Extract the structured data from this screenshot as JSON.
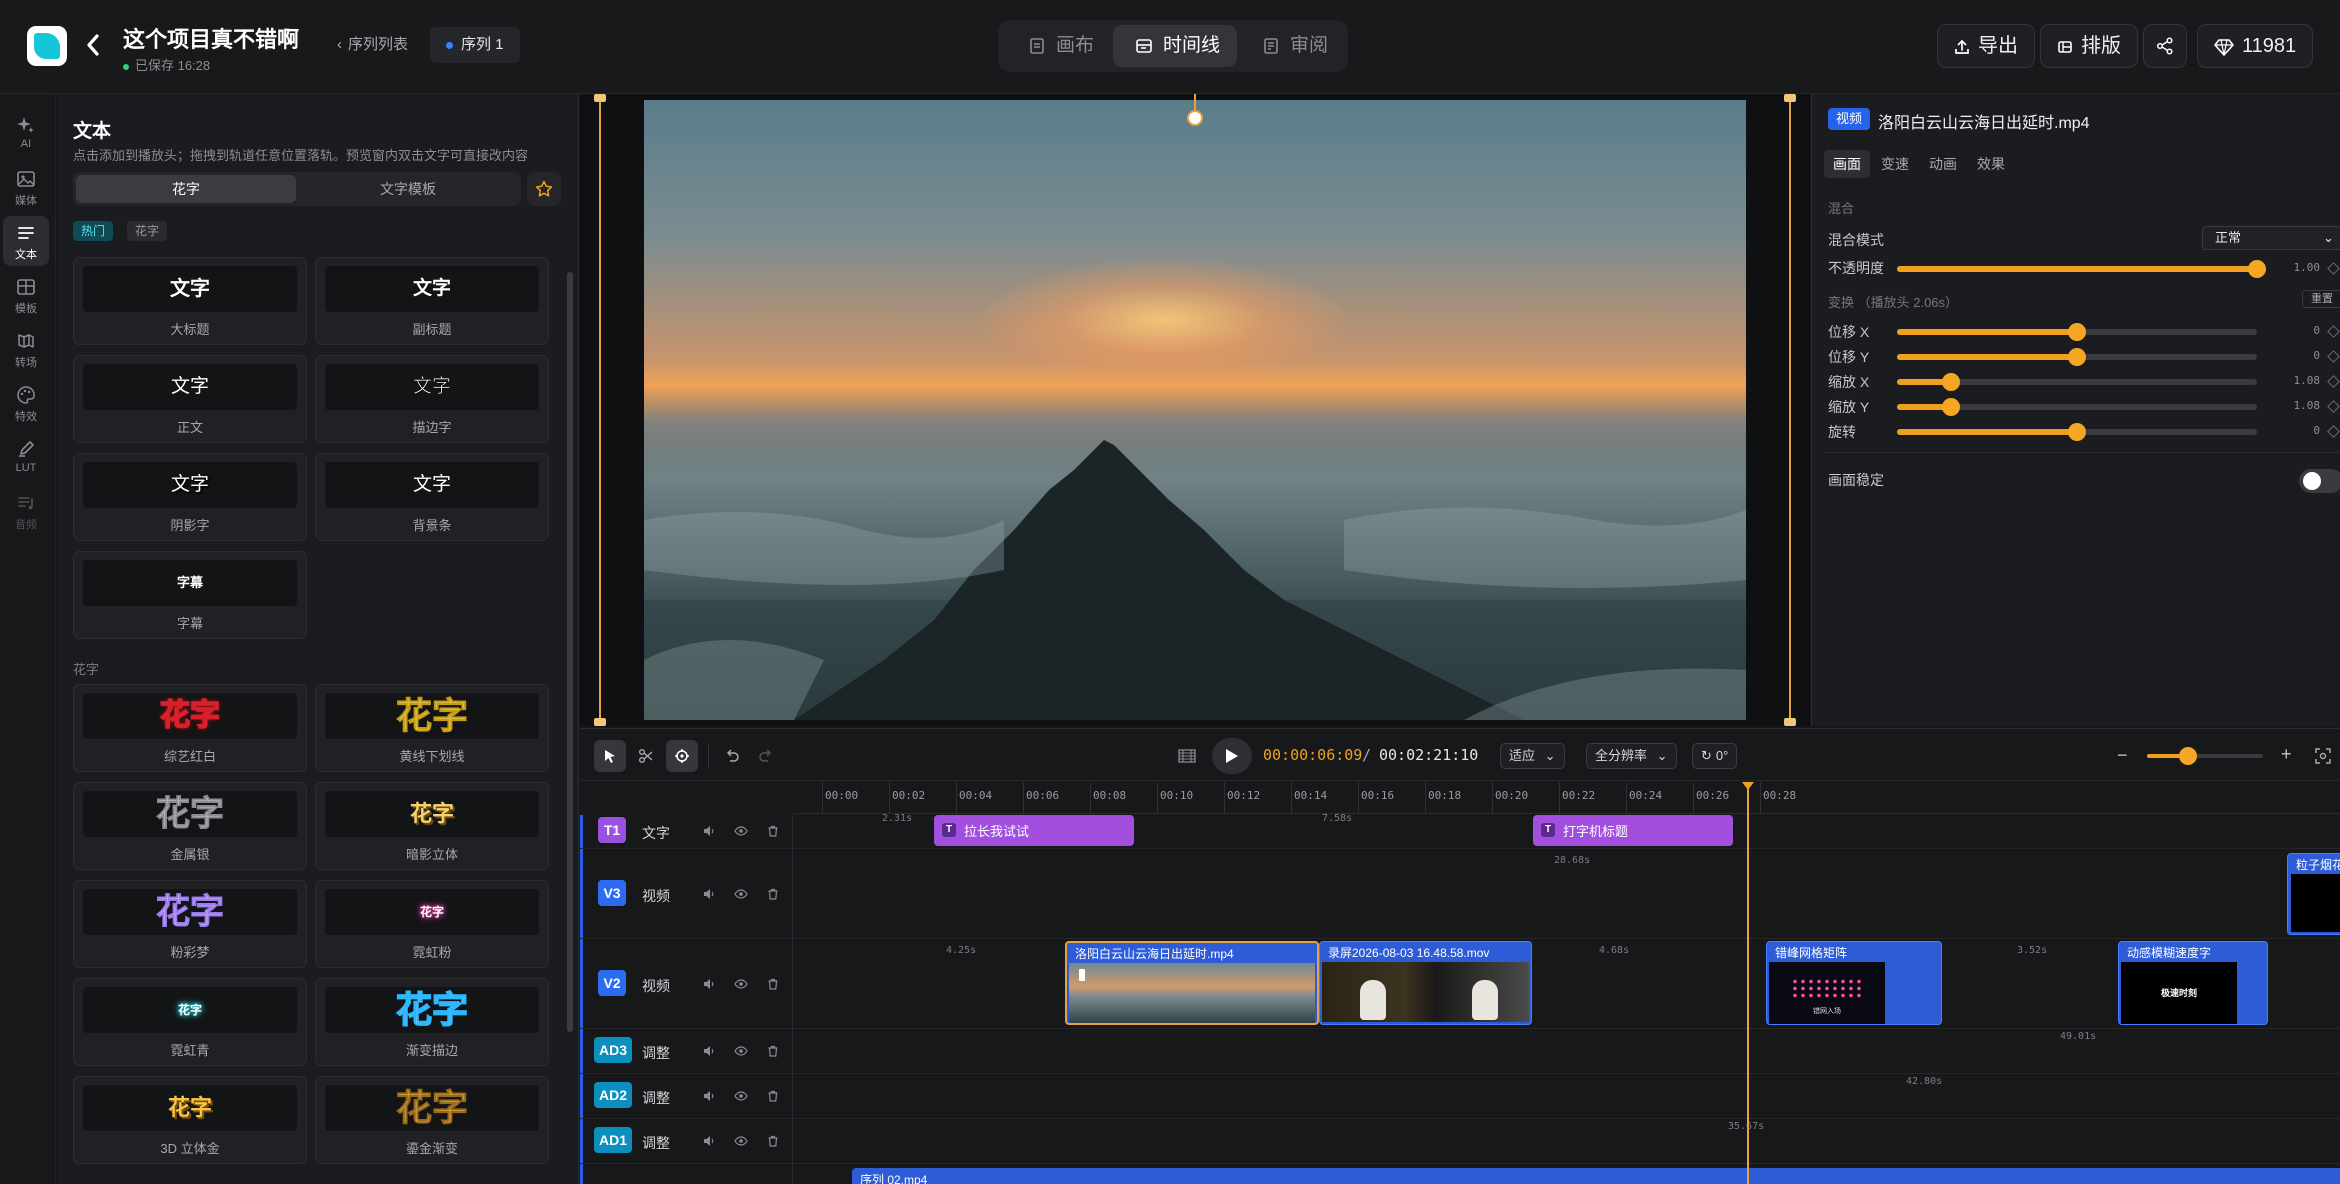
{
  "header": {
    "project_title": "这个项目真不错啊",
    "saved_status": "已保存 16:28",
    "breadcrumb": "序列列表",
    "sequence_badge": "序列 1",
    "view_tabs": [
      {
        "label": "画布",
        "icon": "canvas-icon"
      },
      {
        "label": "时间线",
        "icon": "timeline-icon",
        "active": true
      },
      {
        "label": "审阅",
        "icon": "review-icon"
      }
    ],
    "export_label": "导出",
    "layout_label": "排版",
    "credits": "11981"
  },
  "rail": {
    "items": [
      {
        "label": "AI",
        "icon": "sparkle-icon"
      },
      {
        "label": "媒体",
        "icon": "image-icon"
      },
      {
        "label": "文本",
        "icon": "text-icon",
        "active": true
      },
      {
        "label": "模板",
        "icon": "template-icon"
      },
      {
        "label": "转场",
        "icon": "transition-icon"
      },
      {
        "label": "特效",
        "icon": "effects-icon"
      },
      {
        "label": "LUT",
        "icon": "lut-icon"
      },
      {
        "label": "音频",
        "icon": "audio-icon"
      }
    ]
  },
  "text_panel": {
    "title": "文本",
    "hint": "点击添加到播放头；拖拽到轨道任意位置落轨。预览窗内双击文字可直接改内容",
    "segments": [
      "花字",
      "文字模板"
    ],
    "chips": [
      "热门",
      "花字"
    ],
    "section2": "花字",
    "basic_cards": [
      {
        "preview": "文字",
        "label": "大标题"
      },
      {
        "preview": "文字",
        "label": "副标题"
      },
      {
        "preview": "文字",
        "label": "正文"
      },
      {
        "preview": "文字",
        "label": "描边字"
      },
      {
        "preview": "文字",
        "label": "阴影字"
      },
      {
        "preview": "文字",
        "label": "背景条"
      },
      {
        "preview": "字幕",
        "label": "字幕"
      }
    ],
    "fancy_cards": [
      {
        "preview": "花字",
        "label": "综艺红白"
      },
      {
        "preview": "花字",
        "label": "黄线下划线"
      },
      {
        "preview": "花字",
        "label": "金属银"
      },
      {
        "preview": "花字",
        "label": "暗影立体"
      },
      {
        "preview": "花字",
        "label": "粉彩梦"
      },
      {
        "preview": "花字",
        "label": "霓虹粉"
      },
      {
        "preview": "花字",
        "label": "霓虹青"
      },
      {
        "preview": "花字",
        "label": "渐变描边"
      },
      {
        "preview": "花字",
        "label": "3D 立体金"
      },
      {
        "preview": "花字",
        "label": "鎏金渐变"
      }
    ]
  },
  "inspector": {
    "badge": "视频",
    "filename": "洛阳白云山云海日出延时.mp4",
    "tabs": [
      "画面",
      "变速",
      "动画",
      "效果"
    ],
    "section_mix": "混合",
    "blend_label": "混合模式",
    "blend_value": "正常",
    "opacity_label": "不透明度",
    "opacity_value": "1.00",
    "opacity": 1.0,
    "section_transform": "变换 （播放头 2.06s）",
    "reset_label": "重置",
    "transform": [
      {
        "label": "位移 X",
        "value": "0",
        "fraction": 0.5
      },
      {
        "label": "位移 Y",
        "value": "0",
        "fraction": 0.5
      },
      {
        "label": "缩放 X",
        "value": "1.08",
        "fraction": 0.15
      },
      {
        "label": "缩放 Y",
        "value": "1.08",
        "fraction": 0.15
      },
      {
        "label": "旋转",
        "value": "0",
        "fraction": 0.5
      }
    ],
    "stabilize_label": "画面稳定",
    "stabilize_on": false
  },
  "timeline": {
    "current_time": "00:00:06:09",
    "separator": "/",
    "total_time": "00:02:21:10",
    "fit_label": "适应",
    "resolution_label": "全分辨率",
    "rotation_label": "0°",
    "zoom": 0.35,
    "ruler": [
      "00:00",
      "00:02",
      "00:04",
      "00:06",
      "00:08",
      "00:10",
      "00:12",
      "00:14",
      "00:16",
      "00:18",
      "00:20",
      "00:22",
      "00:24",
      "00:26",
      "00:28"
    ],
    "tracks": [
      {
        "id": "T1",
        "name": "文字",
        "color": "#9b51e0"
      },
      {
        "id": "V3",
        "name": "视频",
        "color": "#2d6cf0"
      },
      {
        "id": "V2",
        "name": "视频",
        "color": "#2d6cf0"
      },
      {
        "id": "AD3",
        "name": "调整",
        "color": "#0b8fbf"
      },
      {
        "id": "AD2",
        "name": "调整",
        "color": "#0b8fbf"
      },
      {
        "id": "AD1",
        "name": "调整",
        "color": "#0b8fbf"
      }
    ],
    "clips": {
      "t1_a": "拉长我试试",
      "t1_b": "打字机标题",
      "v3_a": "粒子烟花",
      "v2_a": "洛阳白云山云海日出延时.mp4",
      "v2_b": "录屏2026-08-03 16.48.58.mov",
      "v2_c": "错峰网格矩阵",
      "v2_c_inner": "错网入场",
      "v2_d": "动感模糊速度字",
      "v2_d_inner": "极速时刻",
      "bottom": "序列 02.mp4"
    },
    "gaps": {
      "t1_left": "2.31s",
      "t1_mid": "7.58s",
      "v3": "28.68s",
      "v2_1": "4.25s",
      "v2_2": "4.68s",
      "v2_3": "3.52s",
      "ad3": "49.01s",
      "ad2": "42.80s",
      "ad1": "35.67s"
    }
  },
  "colors": {
    "accent": "#f0a020",
    "selected_tab_bg": "#33353a",
    "text_clip": "#a24fe0",
    "video_clip": "#2d5cd6"
  }
}
